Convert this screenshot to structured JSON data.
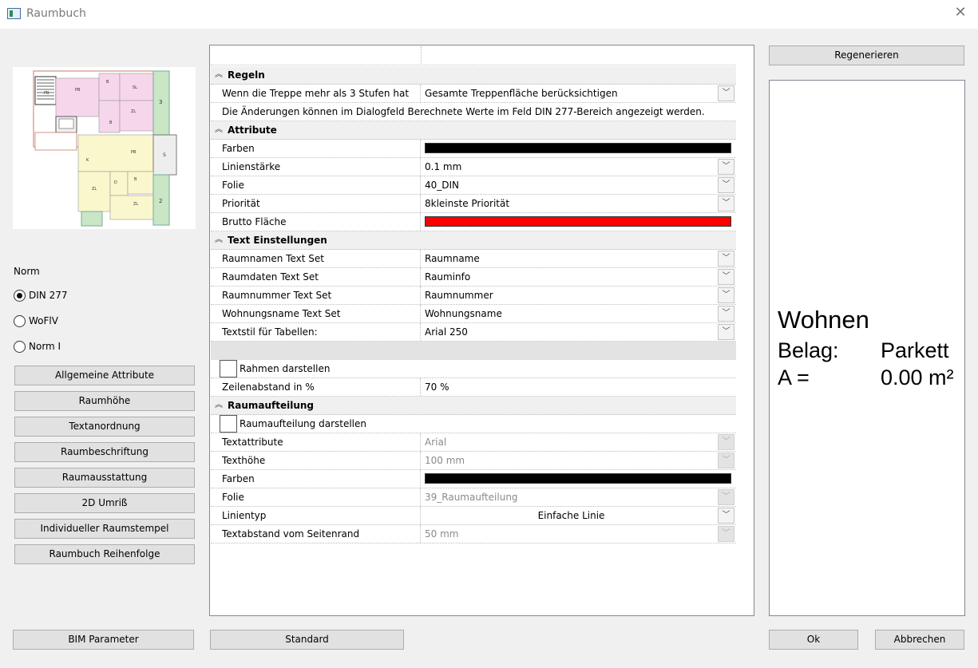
{
  "window": {
    "title": "Raumbuch",
    "close_icon": "close-icon"
  },
  "norm": {
    "label": "Norm",
    "options": [
      {
        "label": "DIN 277",
        "selected": true
      },
      {
        "label": "WoFlV",
        "selected": false
      },
      {
        "label": "Norm I",
        "selected": false
      }
    ]
  },
  "left_buttons": [
    "Allgemeine Attribute",
    "Raumhöhe",
    "Textanordnung",
    "Raumbeschriftung",
    "Raumausstattung",
    "2D Umriß",
    "Individueller Raumstempel",
    "Raumbuch Reihenfolge"
  ],
  "footer": {
    "bim": "BIM Parameter",
    "standard": "Standard",
    "ok": "Ok",
    "cancel": "Abbrechen"
  },
  "regen": "Regenerieren",
  "thumbnail": {
    "labels": {
      "a": "PB",
      "b": "B",
      "c": "SL",
      "d": "B",
      "e": "ZL",
      "f": "3",
      "g": "K",
      "h": "PB",
      "i": "S",
      "j": "ZL",
      "k": "D",
      "l": "B",
      "m": "ZL",
      "n": "2"
    }
  },
  "sections": {
    "regeln": {
      "title": "Regeln",
      "treppe_label": "Wenn die Treppe mehr als 3 Stufen hat",
      "treppe_value": "Gesamte Treppenfläche berücksichtigen",
      "note": "Die Änderungen können im Dialogfeld Berechnete Werte im Feld DIN 277-Bereich angezeigt werden."
    },
    "attribute": {
      "title": "Attribute",
      "farben_label": "Farben",
      "farben_color": "#000000",
      "linien_label": "Linienstärke",
      "linien_value": "0.1 mm",
      "folie_label": "Folie",
      "folie_value": "40_DIN",
      "prio_label": "Priorität",
      "prio_value": "8kleinste Priorität",
      "brutto_label": "Brutto Fläche",
      "brutto_color": "#ff0000"
    },
    "text": {
      "title": "Text Einstellungen",
      "rows": [
        {
          "label": "Raumnamen Text Set",
          "value": "Raumname"
        },
        {
          "label": "Raumdaten Text Set",
          "value": "Rauminfo"
        },
        {
          "label": "Raumnummer Text Set",
          "value": "Raumnummer"
        },
        {
          "label": "Wohnungsname Text Set",
          "value": "Wohnungsname"
        },
        {
          "label": "Textstil für Tabellen:",
          "value": "Arial 250"
        }
      ],
      "rahmen_label": "Rahmen darstellen",
      "zeilen_label": "Zeilenabstand in %",
      "zeilen_value": "70 %"
    },
    "raumaufteilung": {
      "title": "Raumaufteilung",
      "check_label": "Raumaufteilung darstellen",
      "textattr_label": "Textattribute",
      "textattr_value": "Arial",
      "texthoehe_label": "Texthöhe",
      "texthoehe_value": "100 mm",
      "farben_label": "Farben",
      "farben_color": "#000000",
      "folie_label": "Folie",
      "folie_value": "39_Raumaufteilung",
      "linientyp_label": "Linientyp",
      "linientyp_value": "Einfache Linie",
      "abstand_label": "Textabstand vom Seitenrand",
      "abstand_value": "50 mm"
    }
  },
  "preview": {
    "title": "Wohnen",
    "belag_key": "Belag:",
    "belag_value": "Parkett",
    "area_key": "A =",
    "area_value": "0.00 m²"
  }
}
